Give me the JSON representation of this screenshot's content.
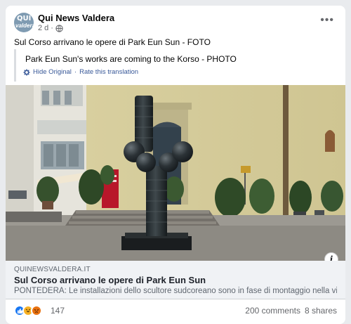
{
  "post": {
    "page_name": "Qui News Valdera",
    "time": "2 d",
    "separator": "·",
    "avatar_text_1": "QUI",
    "avatar_text_2": "valdera",
    "more_label": "•••",
    "text": "Sul Corso arrivano le opere di Park Eun Sun - FOTO",
    "translation": "Park Eun Sun's works are coming to the Korso - PHOTO",
    "hide_original": "Hide Original",
    "link_separator": "·",
    "rate_translation": "Rate this translation"
  },
  "link_preview": {
    "domain": "QUINEWSVALDERA.IT",
    "title": "Sul Corso arrivano le opere di Park Eun Sun",
    "description": "PONTEDERA: Le installazioni dello scultore sudcoreano sono in fase di montaggio nella via ...",
    "info_label": "i"
  },
  "engagement": {
    "reaction_count": "147",
    "comments": "200 comments",
    "shares": "8 shares"
  },
  "icons": [
    "globe-icon",
    "gear-icon",
    "info-icon",
    "like-reaction-icon",
    "haha-reaction-icon",
    "angry-reaction-icon",
    "more-icon"
  ],
  "colors": {
    "link_blue": "#385898",
    "like_blue": "#1877f2",
    "muted": "#65676b"
  }
}
